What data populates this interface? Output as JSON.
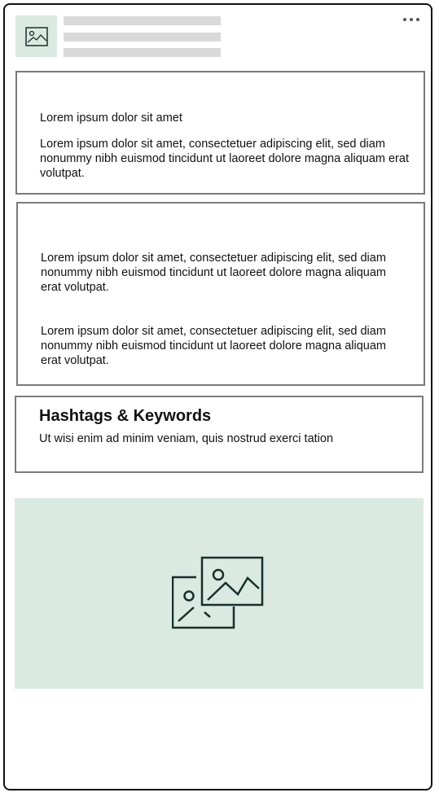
{
  "post": {
    "card1": {
      "title": "Lorem ipsum dolor sit amet",
      "body": "Lorem ipsum dolor sit amet, consectetuer adipiscing elit, sed diam nonummy nibh euismod tincidunt ut laoreet dolore magna aliquam erat volutpat."
    },
    "card2": {
      "paragraph1": "Lorem ipsum dolor sit amet, consectetuer adipiscing elit, sed diam nonummy nibh euismod tincidunt ut laoreet dolore magna aliquam erat volutpat.",
      "paragraph2": "Lorem ipsum dolor sit amet, consectetuer adipiscing elit, sed diam nonummy nibh euismod tincidunt ut laoreet dolore magna aliquam erat volutpat."
    },
    "hashtags": {
      "heading": "Hashtags & Keywords",
      "text": "Ut wisi enim ad minim veniam, quis nostrud exerci tation"
    }
  },
  "icons": {
    "avatar": "image-icon",
    "menu": "more-horizontal-icon",
    "media": "gallery-icon"
  },
  "colors": {
    "placeholder_bg": "#dbe9e3",
    "skeleton": "#d9d9d9",
    "border": "#7a7a7a",
    "icon_stroke": "#17302a"
  }
}
